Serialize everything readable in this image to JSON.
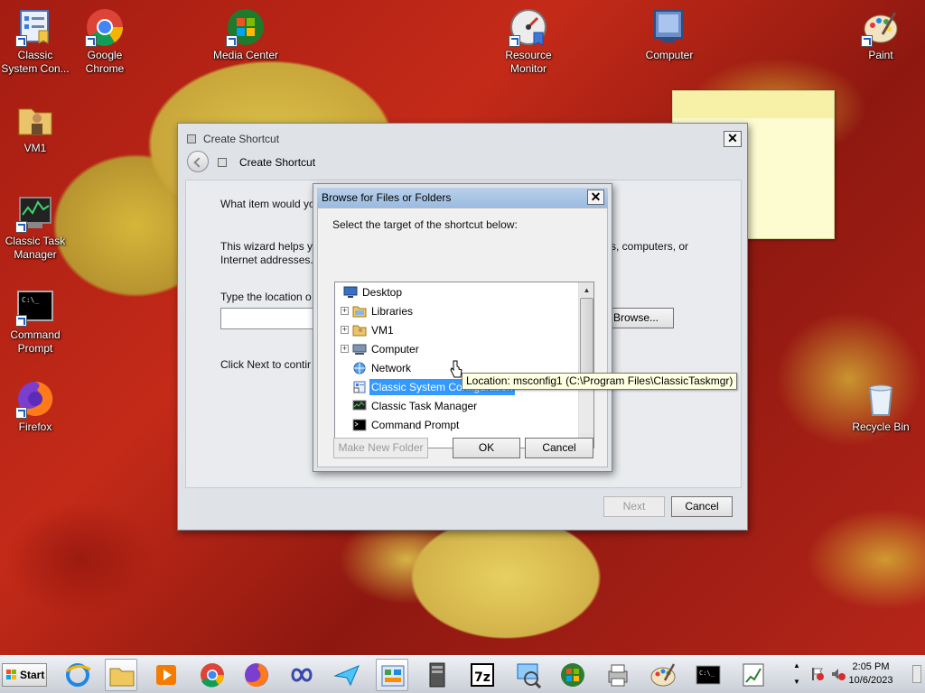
{
  "desktop": {
    "icons": [
      {
        "label": "Classic System Con...",
        "icon": "system-config-icon"
      },
      {
        "label": "Google Chrome",
        "icon": "chrome-icon"
      },
      {
        "label": "Media Center",
        "icon": "media-center-icon"
      },
      {
        "label": "Resource Monitor",
        "icon": "resource-monitor-icon"
      },
      {
        "label": "Computer",
        "icon": "computer-icon"
      },
      {
        "label": "Paint",
        "icon": "paint-icon"
      },
      {
        "label": "VM1",
        "icon": "user-folder-icon"
      },
      {
        "label": "Classic Task Manager",
        "icon": "task-manager-icon"
      },
      {
        "label": "Command Prompt",
        "icon": "command-prompt-icon"
      },
      {
        "label": "Firefox",
        "icon": "firefox-icon"
      },
      {
        "label": "Recycle Bin",
        "icon": "recycle-bin-icon"
      }
    ]
  },
  "wizard": {
    "window_title": "Create Shortcut",
    "header_title": "Create Shortcut",
    "question": "What item would yo",
    "help_line1": "This wizard helps yo",
    "help_line1_tail": "s, computers, or",
    "help_line2": "Internet addresses.",
    "location_label": "Type the location o",
    "location_value": "",
    "browse_label": "Browse...",
    "continue_text": "Click Next to contir",
    "next_label": "Next",
    "cancel_label": "Cancel",
    "close_glyph": "✕"
  },
  "browse_dialog": {
    "title": "Browse for Files or Folders",
    "instruction": "Select the target of the shortcut below:",
    "close_glyph": "✕",
    "tree": [
      {
        "label": "Desktop",
        "expander": "",
        "icon": "desktop-icon"
      },
      {
        "label": "Libraries",
        "expander": "+",
        "icon": "libraries-icon"
      },
      {
        "label": "VM1",
        "expander": "+",
        "icon": "user-folder-icon"
      },
      {
        "label": "Computer",
        "expander": "+",
        "icon": "computer-icon"
      },
      {
        "label": "Network",
        "expander": "",
        "icon": "network-icon"
      },
      {
        "label": "Classic System Configuration",
        "expander": "",
        "icon": "shortcut-icon",
        "selected": true
      },
      {
        "label": "Classic Task Manager",
        "expander": "",
        "icon": "task-manager-icon"
      },
      {
        "label": "Command Prompt",
        "expander": "",
        "icon": "command-prompt-icon"
      },
      {
        "label": "Firefox",
        "expander": "",
        "icon": "firefox-icon"
      }
    ],
    "make_new_folder_label": "Make New Folder",
    "ok_label": "OK",
    "cancel_label": "Cancel",
    "tooltip": "Location: msconfig1 (C:\\Program Files\\ClassicTaskmgr)"
  },
  "taskbar": {
    "start_label": "Start",
    "apps": [
      "internet-explorer-icon",
      "file-explorer-icon",
      "media-player-icon",
      "chrome-icon",
      "firefox-icon",
      "infinity-icon",
      "paper-plane-icon",
      "control-panel-icon",
      "server-icon",
      "7zip-icon",
      "network-monitor-icon",
      "windows-icon",
      "printer-icon",
      "paint-icon",
      "command-prompt-icon",
      "chart-icon"
    ],
    "clock_time": "2:05 PM",
    "clock_date": "10/6/2023"
  },
  "colors": {
    "selection": "#3399ff",
    "titlebar_active": "#9bbbe0",
    "tooltip_bg": "#ffffe1"
  }
}
